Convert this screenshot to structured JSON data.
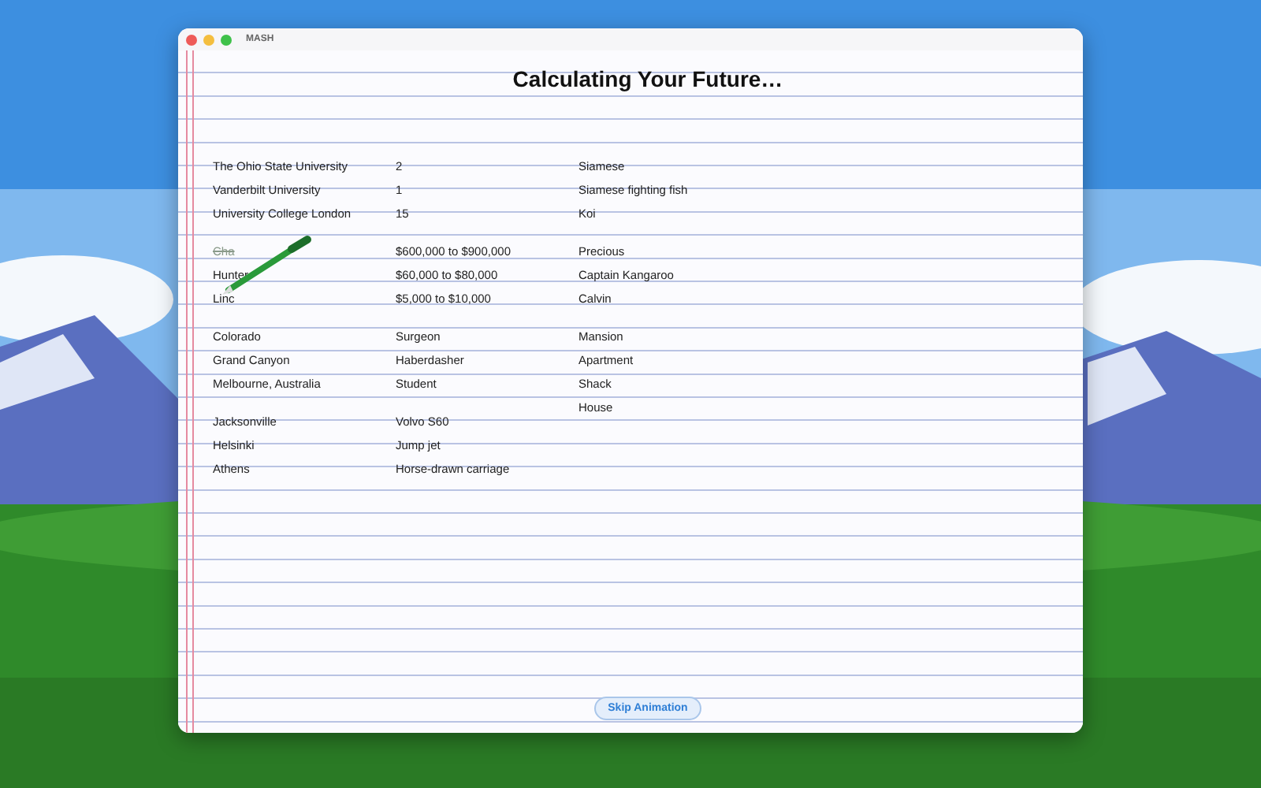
{
  "window": {
    "title": "MASH"
  },
  "heading": "Calculating Your Future…",
  "lists": [
    {
      "items": [
        {
          "text": "The Ohio State University",
          "crossed_out": false
        },
        {
          "text": "Vanderbilt University",
          "crossed_out": false
        },
        {
          "text": "University College London",
          "crossed_out": false
        }
      ]
    },
    {
      "items": [
        {
          "text": "2",
          "crossed_out": false
        },
        {
          "text": "1",
          "crossed_out": false
        },
        {
          "text": "15",
          "crossed_out": false
        }
      ]
    },
    {
      "items": [
        {
          "text": "Siamese",
          "crossed_out": false
        },
        {
          "text": "Siamese fighting fish",
          "crossed_out": false
        },
        {
          "text": "Koi",
          "crossed_out": false
        }
      ]
    },
    {
      "items": [
        {
          "text": "Cha",
          "crossed_out": true
        },
        {
          "text": "Hunter",
          "crossed_out": false
        },
        {
          "text": "Linc",
          "crossed_out": false
        }
      ]
    },
    {
      "items": [
        {
          "text": "$600,000 to $900,000",
          "crossed_out": false
        },
        {
          "text": "$60,000 to $80,000",
          "crossed_out": false
        },
        {
          "text": "$5,000 to $10,000",
          "crossed_out": false
        }
      ]
    },
    {
      "items": [
        {
          "text": "Precious",
          "crossed_out": false
        },
        {
          "text": "Captain Kangaroo",
          "crossed_out": false
        },
        {
          "text": "Calvin",
          "crossed_out": false
        }
      ]
    },
    {
      "items": [
        {
          "text": "Colorado",
          "crossed_out": false
        },
        {
          "text": "Grand Canyon",
          "crossed_out": false
        },
        {
          "text": "Melbourne, Australia",
          "crossed_out": false
        }
      ]
    },
    {
      "items": [
        {
          "text": "Surgeon",
          "crossed_out": false
        },
        {
          "text": "Haberdasher",
          "crossed_out": false
        },
        {
          "text": "Student",
          "crossed_out": false
        }
      ]
    },
    {
      "items": [
        {
          "text": "Mansion",
          "crossed_out": false
        },
        {
          "text": "Apartment",
          "crossed_out": false
        },
        {
          "text": "Shack",
          "crossed_out": false
        },
        {
          "text": "House",
          "crossed_out": false
        }
      ]
    },
    {
      "items": [
        {
          "text": "Jacksonville",
          "crossed_out": false
        },
        {
          "text": "Helsinki",
          "crossed_out": false
        },
        {
          "text": "Athens",
          "crossed_out": false
        }
      ]
    },
    {
      "items": [
        {
          "text": "Volvo S60",
          "crossed_out": false
        },
        {
          "text": "Jump jet",
          "crossed_out": false
        },
        {
          "text": "Horse-drawn carriage",
          "crossed_out": false
        }
      ]
    }
  ],
  "button": "Skip Animation"
}
